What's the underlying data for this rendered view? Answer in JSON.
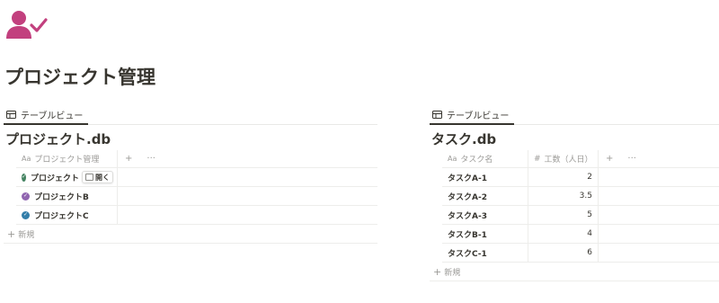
{
  "page": {
    "icon": "person-check-icon",
    "title": "プロジェクト管理",
    "accent_color": "#c2407e"
  },
  "left_db": {
    "view_tab_label": "テーブルビュー",
    "title": "プロジェクト.db",
    "columns": [
      {
        "icon": "Aa",
        "label": "プロジェクト管理"
      }
    ],
    "rows": [
      {
        "name": "プロジェクト",
        "status_color": "#448361",
        "show_open": true
      },
      {
        "name": "プロジェクトB",
        "status_color": "#9065b0"
      },
      {
        "name": "プロジェクトC",
        "status_color": "#337ea9"
      }
    ],
    "open_label": "開く",
    "add_column": "+",
    "more": "···",
    "new_label": "新規"
  },
  "right_db": {
    "view_tab_label": "テーブルビュー",
    "title": "タスク.db",
    "columns": [
      {
        "icon": "Aa",
        "label": "タスク名"
      },
      {
        "icon": "#",
        "label": "工数（人日）"
      }
    ],
    "rows": [
      {
        "name": "タスクA-1",
        "effort": "2"
      },
      {
        "name": "タスクA-2",
        "effort": "3.5"
      },
      {
        "name": "タスクA-3",
        "effort": "5"
      },
      {
        "name": "タスクB-1",
        "effort": "4"
      },
      {
        "name": "タスクC-1",
        "effort": "6"
      }
    ],
    "add_column": "+",
    "more": "···",
    "new_label": "新規"
  }
}
